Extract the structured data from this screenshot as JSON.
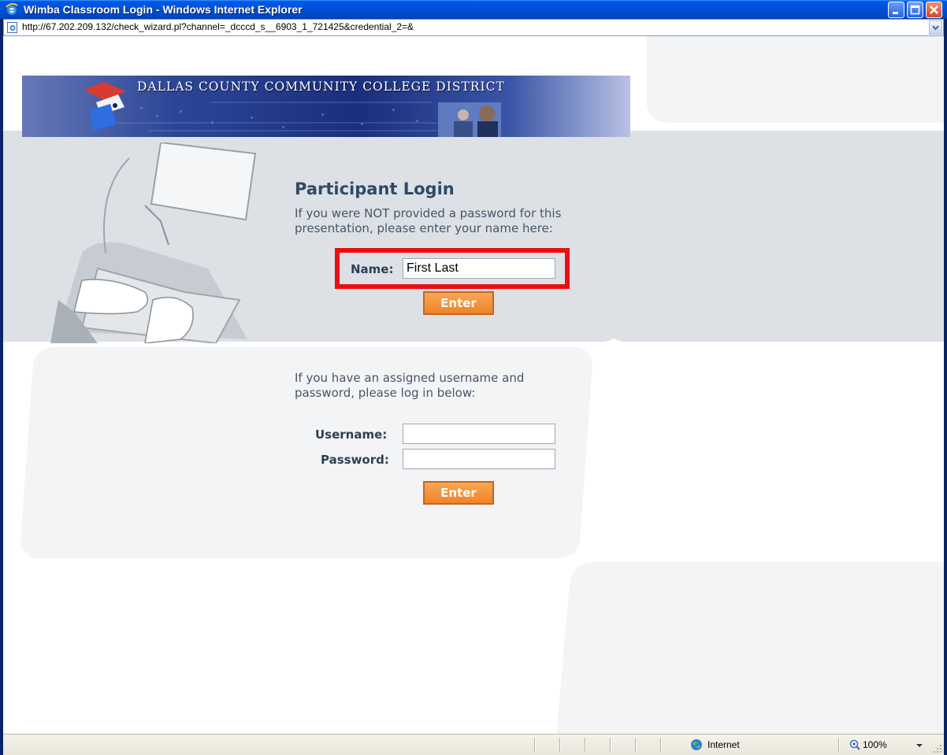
{
  "window": {
    "title": "Wimba Classroom Login - Windows Internet Explorer"
  },
  "address_bar": {
    "url": "http://67.202.209.132/check_wizard.pl?channel=_dcccd_s__6903_1_721425&credential_2=&"
  },
  "banner": {
    "title": "DALLAS COUNTY COMMUNITY COLLEGE DISTRICT"
  },
  "participant_login": {
    "heading": "Participant Login",
    "instruction_line1": "If you were NOT provided a password for this",
    "instruction_line2": "presentation, please enter your name here:",
    "name_label": "Name:",
    "name_value": "First Last",
    "enter_label": "Enter"
  },
  "assigned_login": {
    "instruction_line1": "If you have an assigned username and",
    "instruction_line2": "password, please log in below:",
    "username_label": "Username:",
    "username_value": "",
    "password_label": "Password:",
    "password_value": "",
    "enter_label": "Enter"
  },
  "status_bar": {
    "zone": "Internet",
    "zoom": "100%"
  },
  "colors": {
    "highlight": "#ea0f11",
    "enter_button": "#f3953d",
    "heading": "#2e4a66"
  }
}
